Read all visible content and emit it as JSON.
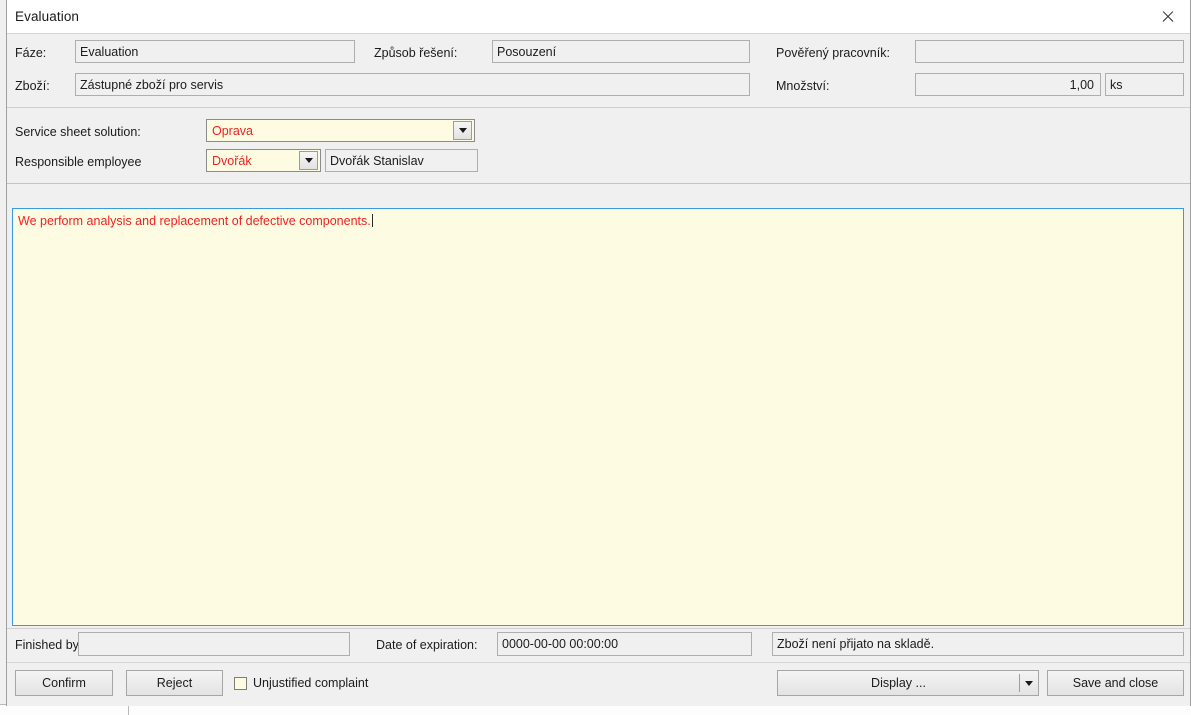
{
  "window": {
    "title": "Evaluation",
    "close_icon": "close-icon"
  },
  "header": {
    "phase_label": "Fáze:",
    "phase_value": "Evaluation",
    "solution_method_label": "Způsob řešení:",
    "solution_method_value": "Posouzení",
    "assigned_worker_label": "Pověřený pracovník:",
    "assigned_worker_value": "",
    "goods_label": "Zboží:",
    "goods_value": "Zástupné zboží pro servis",
    "quantity_label": "Množství:",
    "quantity_value": "1,00",
    "quantity_unit": "ks"
  },
  "solution": {
    "sheet_solution_label": "Service sheet solution:",
    "sheet_solution_value": "Oprava",
    "responsible_employee_label": "Responsible employee",
    "responsible_employee_value": "Dvořák",
    "responsible_employee_full": "Dvořák Stanislav",
    "dropdown_icon": "chevron-down-icon"
  },
  "note": {
    "text": "We perform analysis and replacement of defective components."
  },
  "status": {
    "finished_by_label": "Finished by",
    "finished_by_value": "",
    "expiration_label": "Date of expiration:",
    "expiration_value": "0000-00-00 00:00:00",
    "stock_message": "Zboží není přijato na skladě."
  },
  "footer": {
    "confirm_label": "Confirm",
    "reject_label": "Reject",
    "unjustified_label": "Unjustified complaint",
    "unjustified_checked": false,
    "display_label": "Display ...",
    "display_dropdown_icon": "chevron-down-icon",
    "save_close_label": "Save and close"
  },
  "colors": {
    "accent_red": "#ee2222",
    "field_cream": "#fdfce3",
    "focus_blue": "#3a9ade",
    "window_gray": "#f0f0f0"
  }
}
